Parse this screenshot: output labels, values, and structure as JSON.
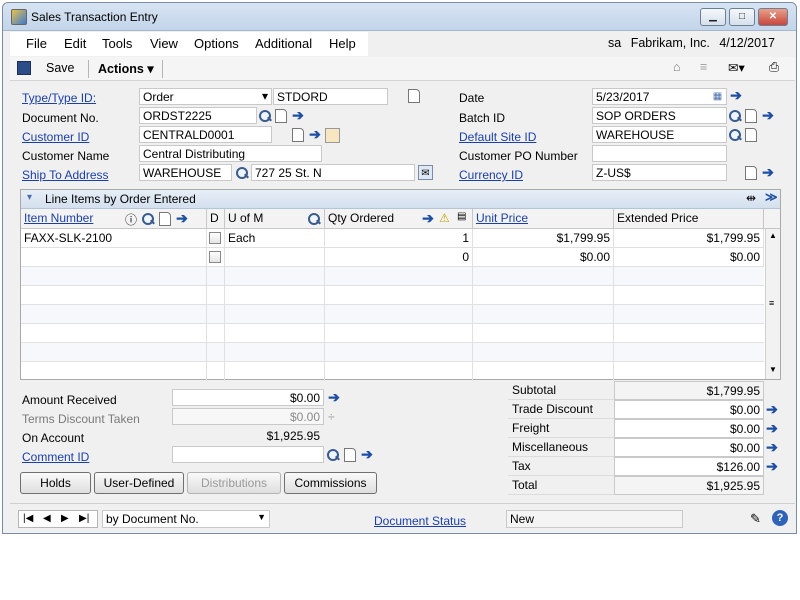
{
  "window": {
    "title": "Sales Transaction Entry",
    "minimize": "▁",
    "maximize": "□",
    "close": "✕"
  },
  "menu": {
    "items": [
      "File",
      "Edit",
      "Tools",
      "View",
      "Options",
      "Additional",
      "Help"
    ]
  },
  "session": {
    "user": "sa",
    "company": "Fabrikam, Inc.",
    "date": "4/12/2017"
  },
  "toolbar": {
    "save_label": "Save",
    "actions_label": "Actions"
  },
  "form": {
    "type_label": "Type/Type ID:",
    "type_value": "Order",
    "type_id_value": "STDORD",
    "docno_label": "Document No.",
    "docno_value": "ORDST2225",
    "customer_id_label": "Customer ID",
    "customer_id_value": "CENTRALD0001",
    "customer_name_label": "Customer Name",
    "customer_name_value": "Central Distributing",
    "ship_to_label": "Ship To Address",
    "ship_to_id": "WAREHOUSE",
    "ship_to_address": "727 25 St. N",
    "date_label": "Date",
    "date_value": "5/23/2017",
    "batch_label": "Batch ID",
    "batch_value": "SOP ORDERS",
    "site_label": "Default Site ID",
    "site_value": "WAREHOUSE",
    "po_label": "Customer PO Number",
    "po_value": "",
    "currency_label": "Currency ID",
    "currency_value": "Z-US$"
  },
  "grid": {
    "title": "Line Items by Order Entered",
    "columns": {
      "item": "Item Number",
      "d": "D",
      "uom": "U of M",
      "qty": "Qty Ordered",
      "price": "Unit Price",
      "ext": "Extended Price"
    },
    "rows": [
      {
        "item": "FAXX-SLK-2100",
        "uom": "Each",
        "qty": "1",
        "price": "$1,799.95",
        "ext": "$1,799.95"
      },
      {
        "item": "",
        "uom": "",
        "qty": "0",
        "price": "$0.00",
        "ext": "$0.00"
      }
    ]
  },
  "left_totals": {
    "amount_received_label": "Amount Received",
    "amount_received": "$0.00",
    "terms_label": "Terms Discount Taken",
    "terms": "$0.00",
    "on_account_label": "On Account",
    "on_account": "$1,925.95",
    "comment_label": "Comment ID",
    "comment": ""
  },
  "totals": {
    "subtotal_label": "Subtotal",
    "subtotal": "$1,799.95",
    "trade_label": "Trade Discount",
    "trade": "$0.00",
    "freight_label": "Freight",
    "freight": "$0.00",
    "misc_label": "Miscellaneous",
    "misc": "$0.00",
    "tax_label": "Tax",
    "tax": "$126.00",
    "total_label": "Total",
    "total": "$1,925.95"
  },
  "buttons": {
    "holds": "Holds",
    "user_defined": "User-Defined",
    "distributions": "Distributions",
    "commissions": "Commissions"
  },
  "nav": {
    "sort_value": "by Document No.",
    "doc_status_label": "Document Status",
    "status_value": "New"
  }
}
